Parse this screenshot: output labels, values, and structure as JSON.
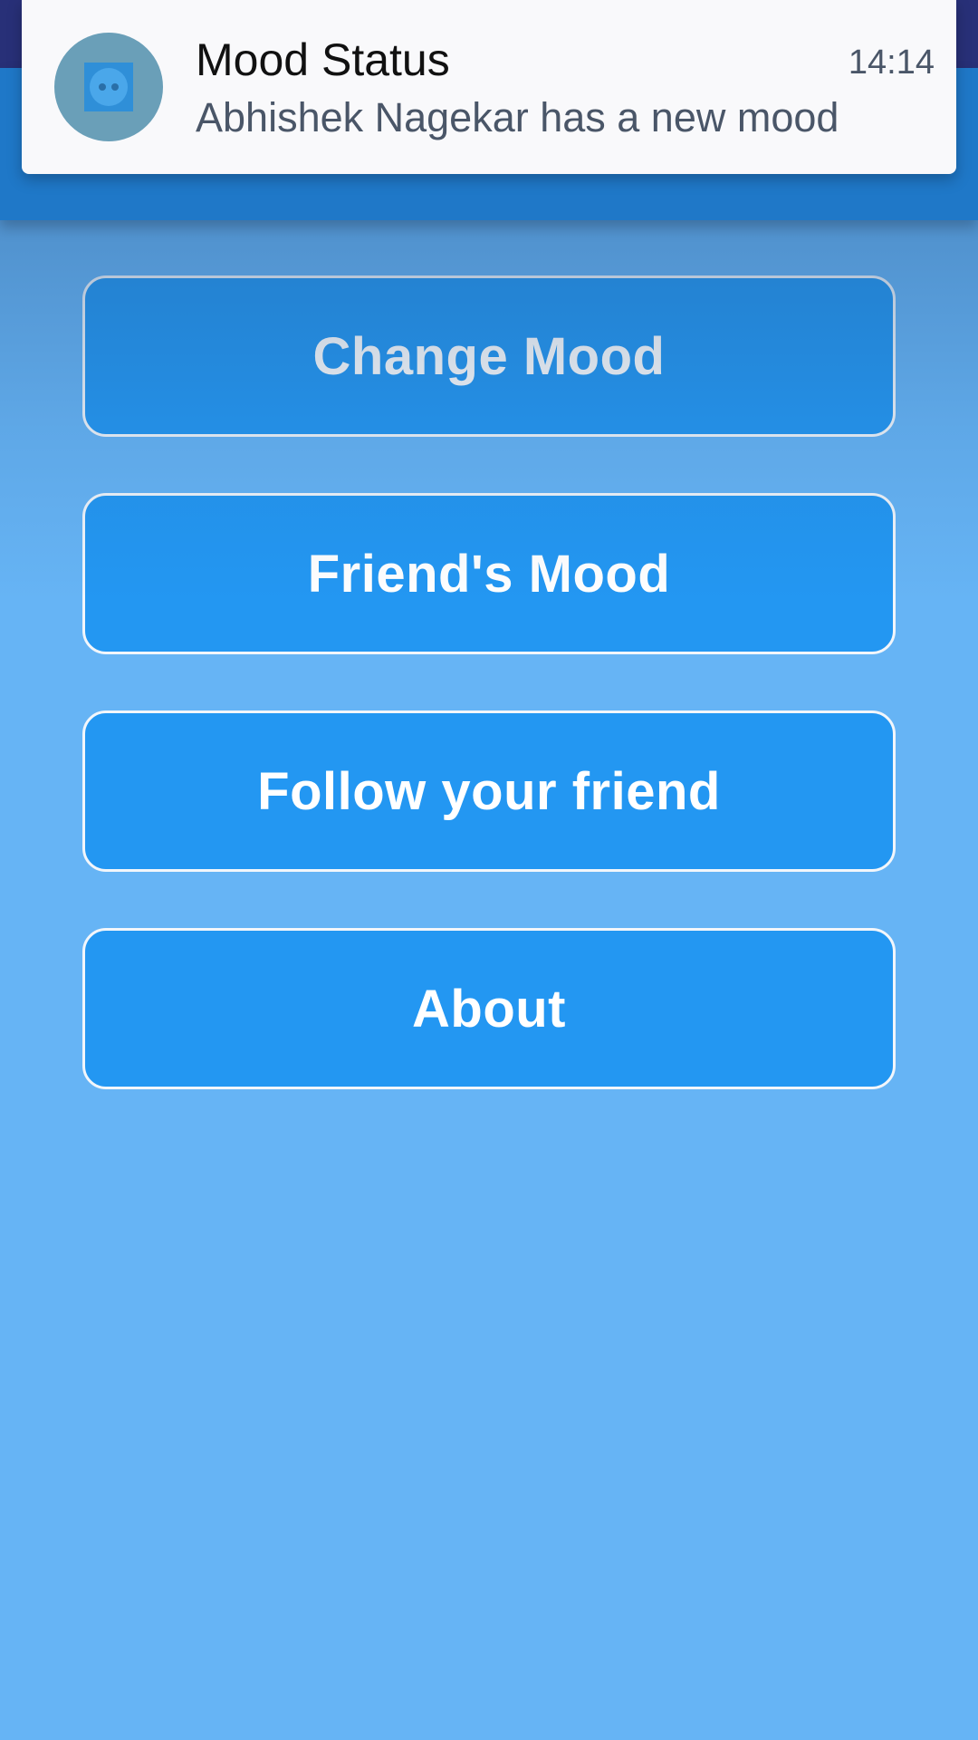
{
  "notification": {
    "title": "Mood Status",
    "message": "Abhishek Nagekar has a new mood",
    "time": "14:14",
    "icon": "mood-face-icon"
  },
  "menu": {
    "buttons": [
      {
        "label": "Change Mood"
      },
      {
        "label": "Friend's Mood"
      },
      {
        "label": "Follow your friend"
      },
      {
        "label": "About"
      }
    ]
  },
  "colors": {
    "status_bar": "#283078",
    "app_bar": "#1f78c8",
    "background": "#66b4f5",
    "button": "#2397f2",
    "button_border": "#f2f6fb",
    "notification_bg": "#f9f9fb"
  }
}
